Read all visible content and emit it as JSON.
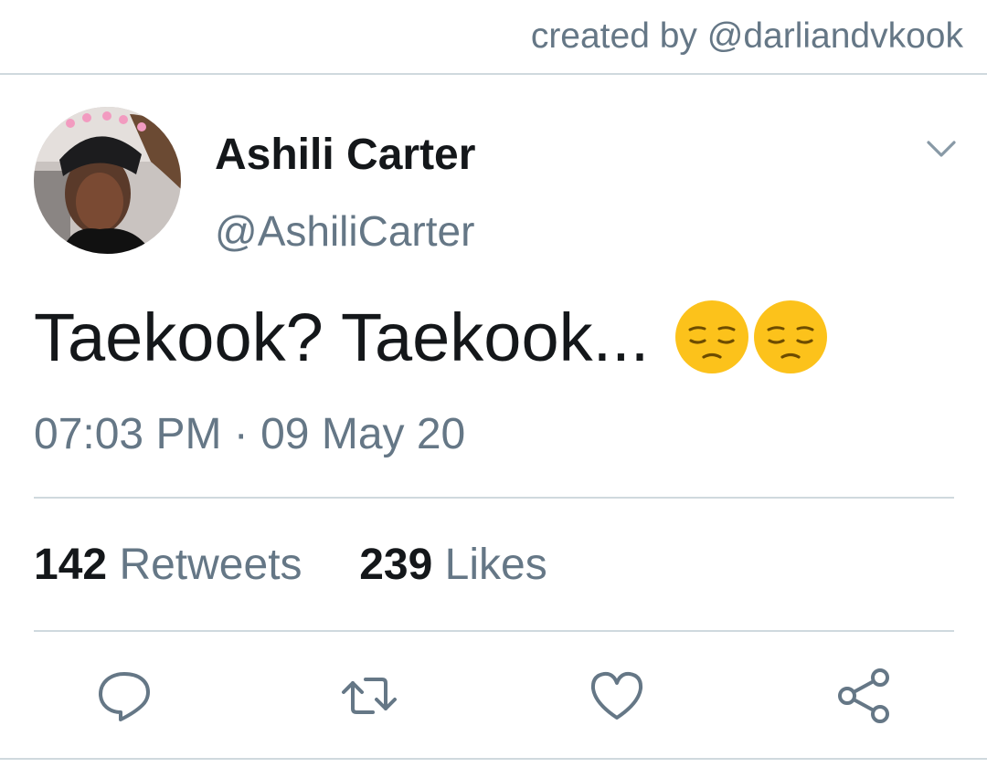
{
  "header": {
    "credit": "created by @darliandvkook"
  },
  "tweet": {
    "author_name": "Ashili Carter",
    "author_handle": "@AshiliCarter",
    "text": "Taekook? Taekook...",
    "emojis": [
      "pensive-face-emoji",
      "pensive-face-emoji"
    ],
    "timestamp": "07:03 PM · 09 May 20",
    "retweets_count": "142",
    "retweets_label": "Retweets",
    "likes_count": "239",
    "likes_label": "Likes"
  },
  "actions": [
    "reply-icon",
    "retweet-icon",
    "like-icon",
    "share-icon"
  ],
  "colors": {
    "text_primary": "#14171a",
    "text_secondary": "#657786",
    "divider": "#cfd9de",
    "emoji_yellow": "#fcc21b"
  }
}
